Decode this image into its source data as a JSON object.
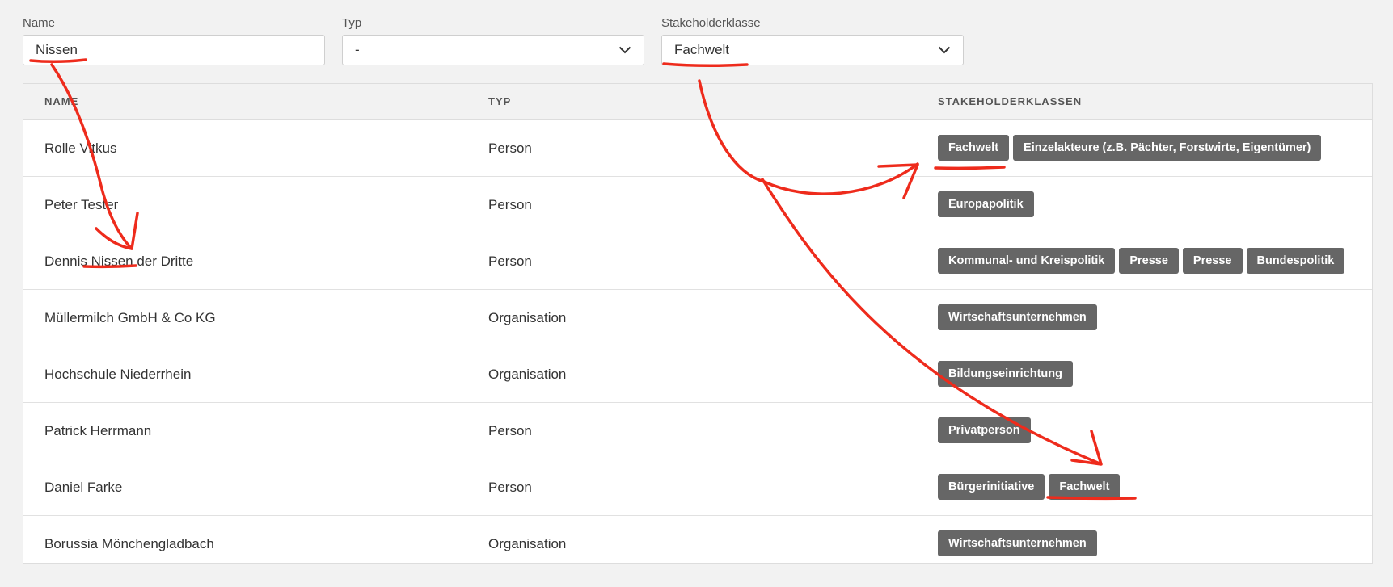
{
  "filters": {
    "name": {
      "label": "Name",
      "value": "Nissen"
    },
    "typ": {
      "label": "Typ",
      "value": "-"
    },
    "stakeholderklasse": {
      "label": "Stakeholderklasse",
      "value": "Fachwelt"
    }
  },
  "table": {
    "headers": {
      "name": "NAME",
      "typ": "TYP",
      "klassen": "STAKEHOLDERKLASSEN"
    },
    "rows": [
      {
        "name": "Rolle Vitkus",
        "typ": "Person",
        "tags": [
          "Fachwelt",
          "Einzelakteure (z.B. Pächter, Forstwirte, Eigentümer)"
        ]
      },
      {
        "name": "Peter Tester",
        "typ": "Person",
        "tags": [
          "Europapolitik"
        ]
      },
      {
        "name": "Dennis Nissen der Dritte",
        "typ": "Person",
        "tags": [
          "Kommunal- und Kreispolitik",
          "Presse",
          "Presse",
          "Bundespolitik"
        ]
      },
      {
        "name": "Müllermilch GmbH & Co KG",
        "typ": "Organisation",
        "tags": [
          "Wirtschaftsunternehmen"
        ]
      },
      {
        "name": "Hochschule Niederrhein",
        "typ": "Organisation",
        "tags": [
          "Bildungseinrichtung"
        ]
      },
      {
        "name": "Patrick Herrmann",
        "typ": "Person",
        "tags": [
          "Privatperson"
        ]
      },
      {
        "name": "Daniel Farke",
        "typ": "Person",
        "tags": [
          "Bürgerinitiative",
          "Fachwelt"
        ]
      },
      {
        "name": "Borussia Mönchengladbach",
        "typ": "Organisation",
        "tags": [
          "Wirtschaftsunternehmen"
        ]
      }
    ]
  },
  "colors": {
    "tag_bg": "#666666",
    "annotation": "#ee2b1c",
    "page_bg": "#f2f2f2"
  },
  "icons": {
    "select_chevron": "chevron-down-icon"
  }
}
